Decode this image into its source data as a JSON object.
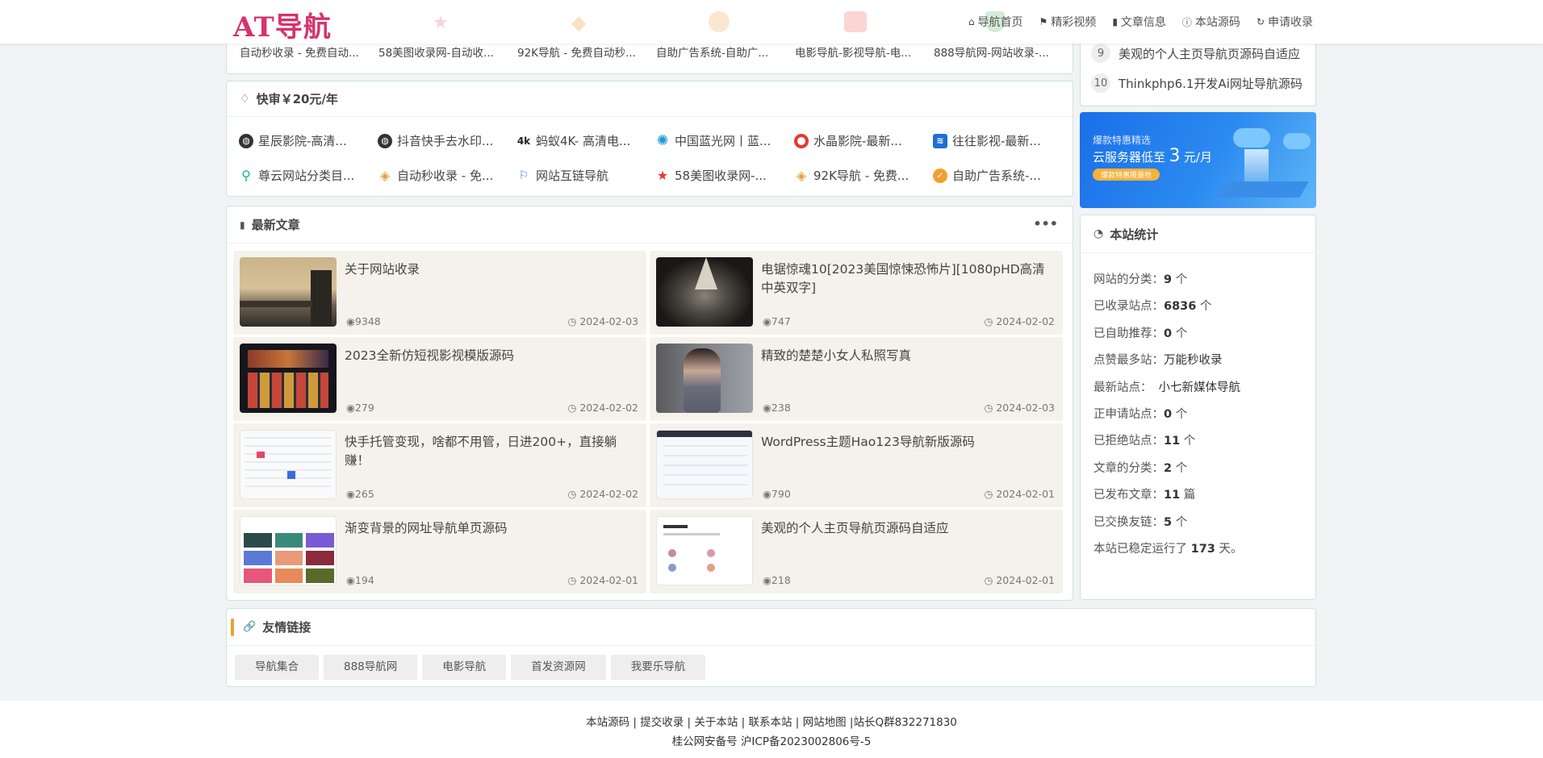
{
  "header": {
    "logo": "AT导航",
    "nav": [
      "导航首页",
      "精彩视频",
      "文章信息",
      "本站源码",
      "申请收录"
    ]
  },
  "top_strip": [
    "自动秒收录 - 免费自动...",
    "58美图收录网-自动收...",
    "92K导航 - 免费自动秒...",
    "自助广告系统-自助广...",
    "电影导航-影视导航-电...",
    "888导航网-网站收录-..."
  ],
  "fast_review": {
    "title": "快审￥20元/年",
    "row1": [
      {
        "label": "星辰影院-高清...",
        "icon": "globe-icon",
        "color": "#333333"
      },
      {
        "label": "抖音快手去水印...",
        "icon": "globe-icon",
        "color": "#333333"
      },
      {
        "label": "蚂蚁4K- 高清电...",
        "icon": "4k-icon",
        "color": "#333333"
      },
      {
        "label": "中国蓝光网丨蓝...",
        "icon": "sun-icon",
        "color": "#1e9ad6"
      },
      {
        "label": "水晶影院-最新...",
        "icon": "ring-icon",
        "color": "#e8382e"
      },
      {
        "label": "往往影视-最新...",
        "icon": "wave-icon",
        "color": "#1e6fd6"
      }
    ],
    "row2": [
      {
        "label": "尊云网站分类目...",
        "icon": "search-icon",
        "color": "#19b28a"
      },
      {
        "label": "自动秒收录 - 免...",
        "icon": "diamond-icon",
        "color": "#e0a33a"
      },
      {
        "label": "网站互链导航",
        "icon": "link-icon",
        "color": "#3a7bd5"
      },
      {
        "label": "58美图收录网-...",
        "icon": "star-icon",
        "color": "#e33b3b"
      },
      {
        "label": "92K导航 - 免费...",
        "icon": "diamond-icon",
        "color": "#e0a33a"
      },
      {
        "label": "自助广告系统-...",
        "icon": "check-badge-icon",
        "color": "#f0a030"
      }
    ]
  },
  "articles": {
    "title": "最新文章",
    "items": [
      {
        "title": "关于网站收录",
        "views": "9348",
        "date": "2024-02-03"
      },
      {
        "title": "电锯惊魂10[2023美国惊悚恐怖片][1080pHD高清中英双字]",
        "views": "747",
        "date": "2024-02-02"
      },
      {
        "title": "2023全新仿短视影视模版源码",
        "views": "279",
        "date": "2024-02-02"
      },
      {
        "title": "精致的楚楚小女人私照写真",
        "views": "238",
        "date": "2024-02-03"
      },
      {
        "title": "快手托管变现，啥都不用管，日进200+，直接躺赚！",
        "views": "265",
        "date": "2024-02-02"
      },
      {
        "title": "WordPress主题Hao123导航新版源码",
        "views": "790",
        "date": "2024-02-01"
      },
      {
        "title": "渐变背景的网址导航单页源码",
        "views": "194",
        "date": "2024-02-01"
      },
      {
        "title": "美观的个人主页导航页源码自适应",
        "views": "218",
        "date": "2024-02-01"
      }
    ]
  },
  "sidebar_list": [
    {
      "num": "9",
      "title": "美观的个人主页导航页源码自适应"
    },
    {
      "num": "10",
      "title": "Thinkphp6.1开发Ai网址导航源码"
    }
  ],
  "ad": {
    "line1": "爆款特惠精选",
    "line2a": "云服务器低至",
    "line2b": "3",
    "line2c": "元/月",
    "button": "爆款特惠限量抢"
  },
  "stats": {
    "title": "本站统计",
    "rows": [
      {
        "label": "网站的分类：",
        "value": "9",
        "unit": " 个"
      },
      {
        "label": "已收录站点：",
        "value": "6836",
        "unit": " 个"
      },
      {
        "label": "已自助推荐：",
        "value": "0",
        "unit": " 个"
      },
      {
        "label": "点赞最多站：",
        "value": "万能秒收录",
        "unit": ""
      },
      {
        "label": "最新站点：",
        "value": "小七新媒体导航",
        "unit": ""
      },
      {
        "label": "正申请站点：",
        "value": "0",
        "unit": " 个"
      },
      {
        "label": "已拒绝站点：",
        "value": "11",
        "unit": " 个"
      },
      {
        "label": "文章的分类：",
        "value": "2",
        "unit": " 个"
      },
      {
        "label": "已发布文章：",
        "value": "11",
        "unit": " 篇"
      },
      {
        "label": "已交换友链：",
        "value": "5",
        "unit": " 个"
      }
    ],
    "uptime_pre": "本站已稳定运行了 ",
    "uptime_val": "173",
    "uptime_post": " 天。"
  },
  "friends": {
    "title": "友情链接",
    "links": [
      "导航集合",
      "888导航网",
      "电影导航",
      "首发资源网",
      "我要乐导航"
    ]
  },
  "footer": {
    "line1": "本站源码 | 提交收录 | 关于本站 | 联系本站 | 网站地图 |站长Q群832271830",
    "line2": "桂公网安备号 沪ICP备2023002806号-5"
  }
}
